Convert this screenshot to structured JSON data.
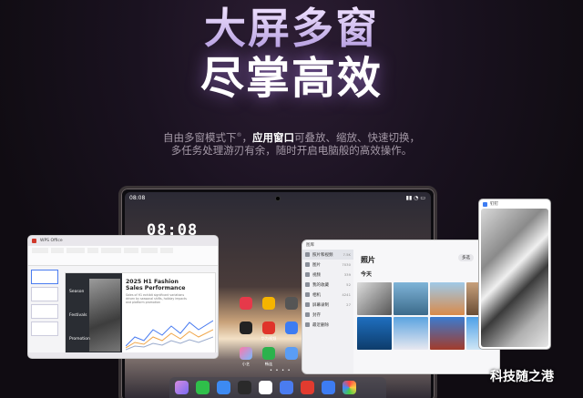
{
  "headline": {
    "line1": "大屏多窗",
    "line2": "尽掌高效"
  },
  "description": {
    "line1_prefix": "自由多窗模式下",
    "line1_sup": "®",
    "line1_bold": "应用窗口",
    "line1_suffix": "可叠放、缩放、快速切换，",
    "line2": "多任务处理游刃有余，随时开启电脑般的高效操作。"
  },
  "tablet": {
    "time_small": "08:08",
    "clock": "08:08"
  },
  "office_window": {
    "tab_label": "WPS Office",
    "slide_title_line1": "2025 H1 Fashion",
    "slide_title_line2": "Sales Performance",
    "slide_subtitle": "Sales of H1 exhibit significant variations driven by seasonal shifts, holiday impacts and platform promotion",
    "labels": [
      "Season",
      "Festivals",
      "Promotion"
    ]
  },
  "gallery_window": {
    "app_name": "图库",
    "title": "照片",
    "today": "今天",
    "select_button": "多选",
    "sidebar": [
      {
        "label": "照片和视频",
        "count": "7.5K",
        "icon": "photo-icon"
      },
      {
        "label": "图片",
        "count": "7030",
        "icon": "image-icon"
      },
      {
        "label": "视频",
        "count": "339",
        "icon": "video-icon"
      },
      {
        "label": "我的收藏",
        "count": "52",
        "icon": "heart-icon"
      },
      {
        "label": "相机",
        "count": "4241",
        "icon": "camera-icon"
      },
      {
        "label": "屏幕录制",
        "count": "27",
        "icon": "screen-record-icon"
      },
      {
        "label": "封存",
        "count": "",
        "icon": "archive-icon"
      },
      {
        "label": "最近删除",
        "count": "",
        "icon": "trash-icon"
      }
    ]
  },
  "phone_window": {
    "app_name": "钉钉"
  },
  "home_apps": [
    "华为视频",
    "计算器",
    "相机",
    "小艺",
    "畅连",
    "天际通"
  ],
  "watermark": "科技随之港",
  "colors": {
    "background": "#140f17",
    "headline_accent": "#d6c2f3",
    "bold_text": "#ffffff"
  }
}
